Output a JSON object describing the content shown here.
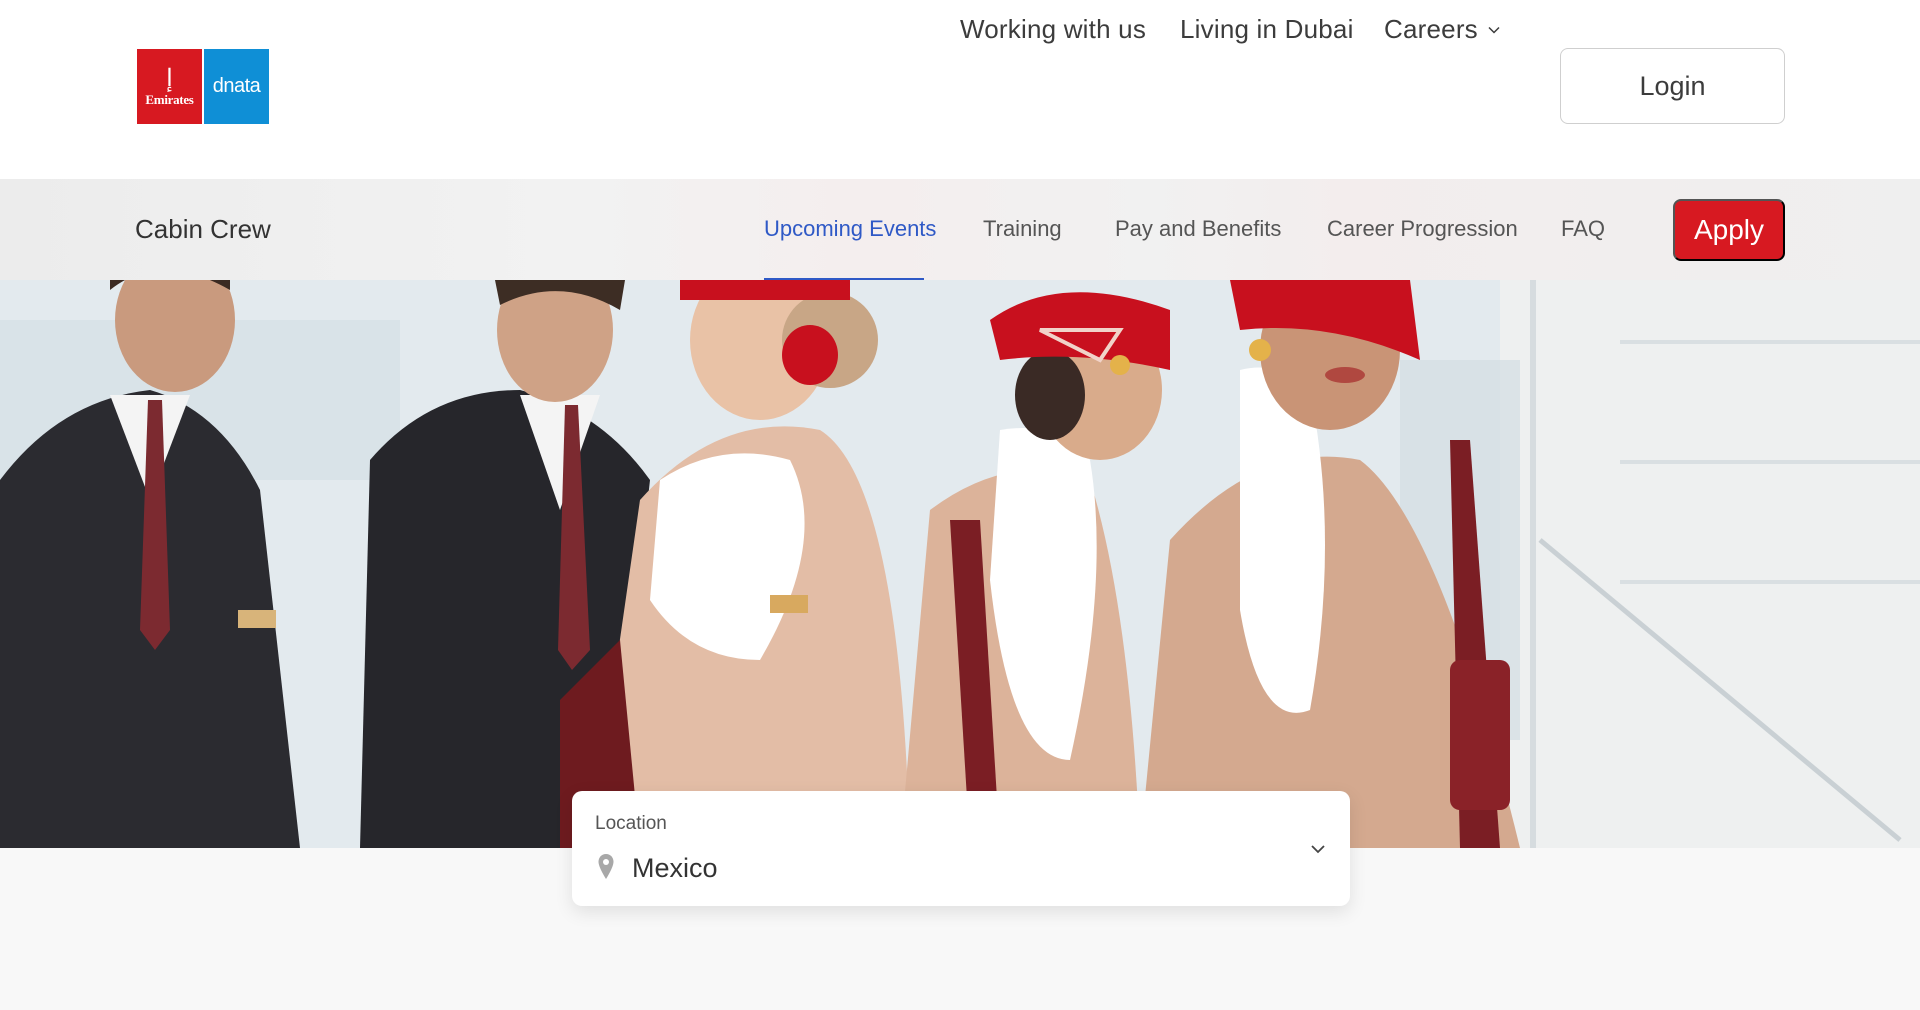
{
  "brand": {
    "emirates_wordmark": "Emirates",
    "dnata_wordmark": "dnata",
    "emirates_color": "#d71921",
    "dnata_color": "#0f8fd6"
  },
  "top_nav": {
    "items": [
      {
        "label": "Working with us"
      },
      {
        "label": "Living in Dubai"
      },
      {
        "label": "Careers",
        "icon": "chevron-down-icon"
      }
    ],
    "login_label": "Login"
  },
  "sub_nav": {
    "section_title": "Cabin Crew",
    "items": [
      {
        "label": "Upcoming Events",
        "active": true
      },
      {
        "label": "Training"
      },
      {
        "label": "Pay and Benefits"
      },
      {
        "label": "Career Progression"
      },
      {
        "label": "FAQ"
      }
    ],
    "apply_label": "Apply",
    "accent_color": "#2f59c6",
    "apply_color": "#d71921"
  },
  "location_filter": {
    "label": "Location",
    "value": "Mexico",
    "icon": "location-pin-icon",
    "dropdown_icon": "chevron-down-icon"
  }
}
